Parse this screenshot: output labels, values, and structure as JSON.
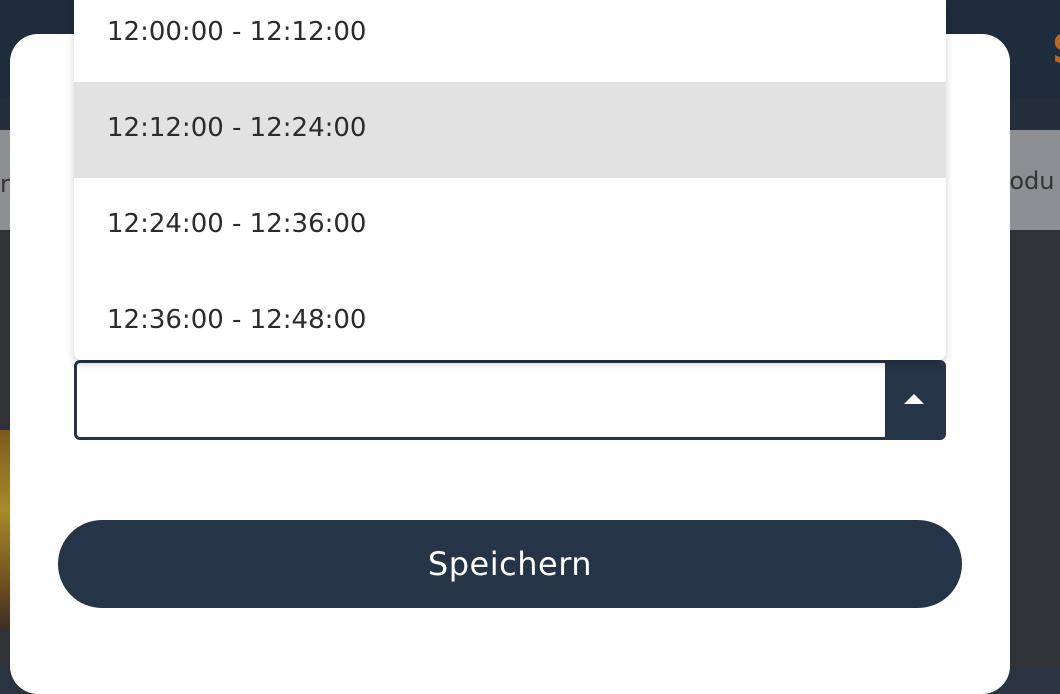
{
  "background": {
    "logo_fragment": "S",
    "nav_left_fragment": "n",
    "nav_right_fragment": "rodu"
  },
  "time_select": {
    "value": "",
    "options": [
      {
        "label": "12:00:00 - 12:12:00",
        "highlighted": false
      },
      {
        "label": "12:12:00 - 12:24:00",
        "highlighted": true
      },
      {
        "label": "12:24:00 - 12:36:00",
        "highlighted": false
      },
      {
        "label": "12:36:00 - 12:48:00",
        "highlighted": false
      }
    ],
    "toggle_icon": "caret-up-icon"
  },
  "save_button": {
    "label": "Speichern"
  },
  "colors": {
    "primary": "#253447",
    "highlight": "#e2e2e2",
    "accent": "#b56a2a"
  }
}
